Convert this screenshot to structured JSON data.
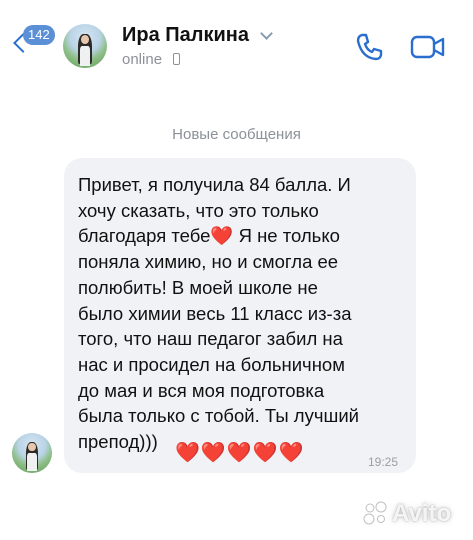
{
  "header": {
    "back_badge": "142",
    "contact_name": "Ира Палкина",
    "status": "online",
    "icons": {
      "back": "chevron-left-icon",
      "call": "phone-icon",
      "video": "video-camera-icon",
      "device": "mobile-phone-icon"
    }
  },
  "divider": {
    "label": "Новые сообщения"
  },
  "message": {
    "text": "Привет, я получила 84 балла. И\nхочу сказать, что это только\nблагодаря тебе❤️ Я не только\nпоняла химию, но и смогла ее\nполюбить! В моей школе не\nбыло химии весь 11 класс из-за\nтого, что наш педагог забил на\nнас и просидел на больничном\nдо мая и вся моя подготовка\nбыла только с тобой. Ты лучший\nпрепод)))",
    "hearts": "❤️❤️❤️❤️❤️",
    "time": "19:25"
  },
  "watermark": {
    "text": "Avito"
  },
  "colors": {
    "accent": "#2a6fcf",
    "badge": "#5b8fd6",
    "bubble": "#f0f2f5",
    "secondary_text": "#8b9197",
    "heart": "#e0262d"
  }
}
